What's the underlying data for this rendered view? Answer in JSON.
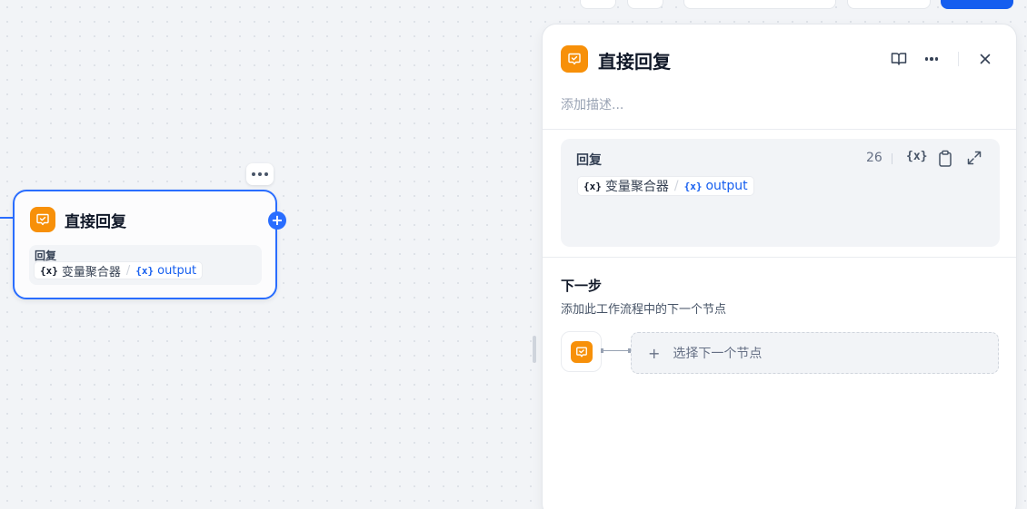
{
  "colors": {
    "accent": "#296dff",
    "node_icon_bg": "#f79009",
    "primary_button": "#155eef"
  },
  "canvas_node": {
    "title": "直接回复",
    "icon": "message-check-icon",
    "field_label": "回复",
    "variable": {
      "source_node": "变量聚合器",
      "separator": "/",
      "name": "output"
    }
  },
  "panel": {
    "title": "直接回复",
    "icon": "message-check-icon",
    "description_placeholder": "添加描述...",
    "reply": {
      "label": "回复",
      "char_count": "26",
      "variable_icon_text": "{x}",
      "variable": {
        "source_node": "变量聚合器",
        "separator": "/",
        "name": "output"
      }
    },
    "next_step": {
      "title": "下一步",
      "description": "添加此工作流程中的下一个节点",
      "select_label": "选择下一个节点"
    }
  }
}
